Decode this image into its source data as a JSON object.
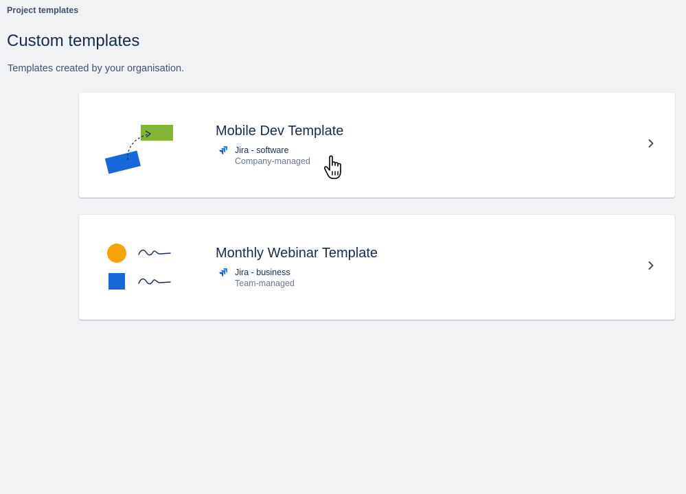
{
  "breadcrumb": "Project templates",
  "page": {
    "title": "Custom templates",
    "description": "Templates created by your organisation."
  },
  "templates": [
    {
      "title": "Mobile Dev Template",
      "product": "Jira - software",
      "management": "Company-managed",
      "illustration": "flow-diagram-illustration"
    },
    {
      "title": "Monthly Webinar Template",
      "product": "Jira - business",
      "management": "Team-managed",
      "illustration": "shapes-list-illustration"
    }
  ],
  "colors": {
    "background": "#f1f2f4",
    "text_primary": "#172b4d",
    "text_secondary": "#6b778c",
    "jira_blue": "#2684ff",
    "illus_blue": "#1868db",
    "illus_green": "#82b536",
    "illus_orange": "#f8a30c"
  },
  "icons": {
    "product": "jira-icon",
    "open": "chevron-right-icon",
    "cursor": "hand-pointer-cursor"
  }
}
